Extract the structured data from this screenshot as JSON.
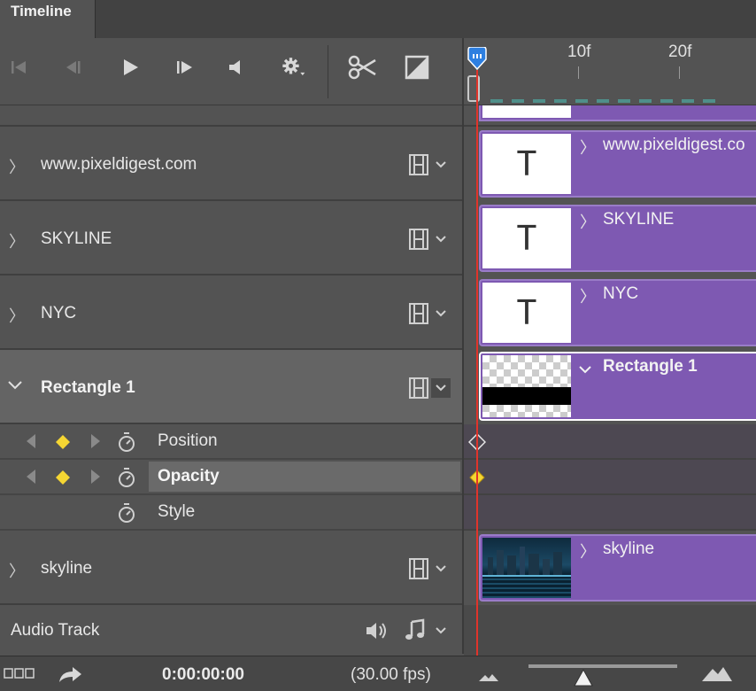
{
  "panel": {
    "tab_label": "Timeline"
  },
  "toolbar": {
    "buttons": [
      "go-to-first-frame",
      "previous-frame",
      "play",
      "next-frame",
      "mute-audio",
      "settings",
      "split-at-playhead",
      "transitions"
    ]
  },
  "ruler": {
    "tick_10": "10f",
    "tick_20": "20f"
  },
  "tracks": [
    {
      "label": "www.pixeldigest.com",
      "clip_title": "www.pixeldigest.co",
      "thumb": "text-layer",
      "thumb_glyph": "T"
    },
    {
      "label": "SKYLINE",
      "clip_title": "SKYLINE",
      "thumb": "text-layer",
      "thumb_glyph": "T"
    },
    {
      "label": "NYC",
      "clip_title": "NYC",
      "thumb": "text-layer",
      "thumb_glyph": "T"
    },
    {
      "label": "Rectangle 1",
      "clip_title": "Rectangle 1",
      "thumb": "shape-layer",
      "expanded": true
    },
    {
      "label": "skyline",
      "clip_title": "skyline",
      "thumb": "image-layer"
    }
  ],
  "properties": [
    {
      "label": "Position",
      "has_keyframe_nav": true,
      "selected": false
    },
    {
      "label": "Opacity",
      "has_keyframe_nav": true,
      "selected": true
    },
    {
      "label": "Style",
      "has_keyframe_nav": false,
      "selected": false
    }
  ],
  "audio": {
    "label": "Audio Track"
  },
  "status": {
    "timecode": "0:00:00:00",
    "fps": "(30.00 fps)"
  },
  "colors": {
    "clip": "#7e59b2",
    "playhead": "#e0342b",
    "keyframe": "#f5d633",
    "accent": "#2d7fe0"
  }
}
